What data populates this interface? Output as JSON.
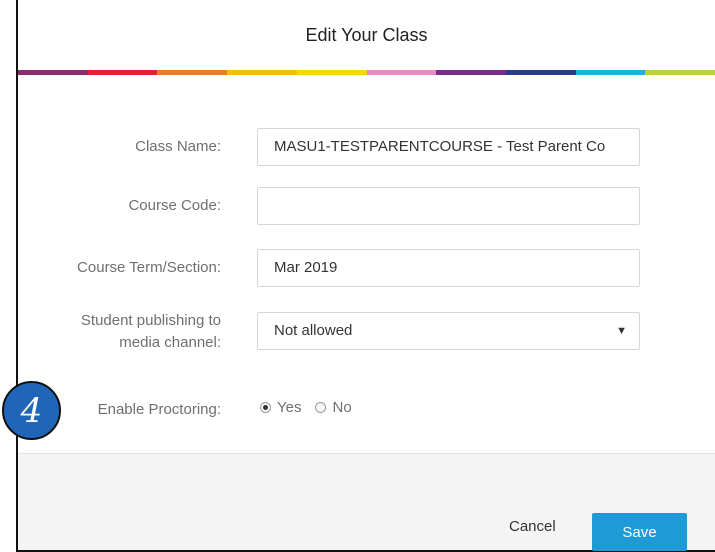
{
  "dialog": {
    "title": "Edit Your Class",
    "rainbow_colors": [
      "#8e2b6b",
      "#d7262e",
      "#f07a22",
      "#fbb91f",
      "#f2d719",
      "#ee86bf",
      "#7a2c8a",
      "#2b3990",
      "#18b3e4",
      "#b7d23b"
    ]
  },
  "form": {
    "class_name": {
      "label": "Class Name:",
      "value": "MASU1-TESTPARENTCOURSE - Test Parent Co"
    },
    "course_code": {
      "label": "Course Code:",
      "value": ""
    },
    "course_term": {
      "label": "Course Term/Section:",
      "value": "Mar 2019"
    },
    "student_publishing": {
      "label_line1": "Student publishing to",
      "label_line2": "media channel:",
      "selected": "Not allowed",
      "arrow_icon": "dropdown-triangle-icon"
    },
    "enable_proctoring": {
      "label": "Enable Proctoring:",
      "options": [
        {
          "label": "Yes",
          "selected": true
        },
        {
          "label": "No",
          "selected": false
        }
      ]
    }
  },
  "footer": {
    "cancel_label": "Cancel",
    "save_label": "Save",
    "save_color": "#1e9ad6"
  },
  "annotation": {
    "step_number": "4",
    "badge_color": "#1f66b8"
  }
}
